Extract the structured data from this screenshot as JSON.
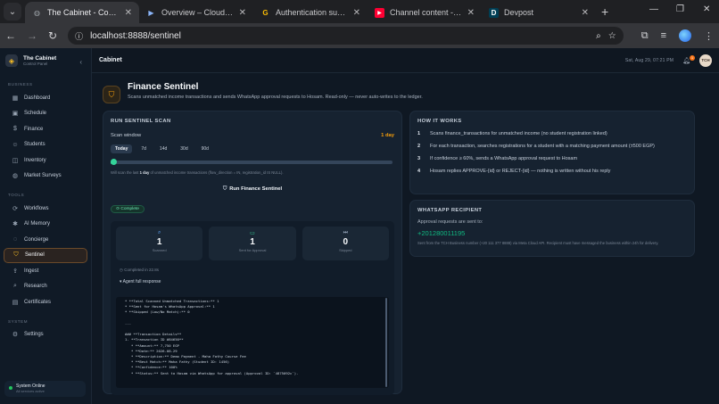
{
  "browser": {
    "tabs": [
      {
        "title": "The Cabinet - Control Ce",
        "icon": "globe-icon",
        "active": true
      },
      {
        "title": "Overview – Cloud Run – I",
        "icon": "cloud-run-icon",
        "active": false
      },
      {
        "title": "Authentication successfu",
        "icon": "google-icon",
        "active": false
      },
      {
        "title": "Channel content - YouTu",
        "icon": "youtube-icon",
        "active": false
      },
      {
        "title": "Devpost",
        "icon": "devpost-icon",
        "active": false
      }
    ],
    "url": "localhost:8888/sentinel"
  },
  "sidebar": {
    "brand_title": "The Cabinet",
    "brand_sub": "Control Panel",
    "sections": [
      {
        "label": "BUSINESS",
        "items": [
          {
            "label": "Dashboard",
            "icon": "grid-icon"
          },
          {
            "label": "Schedule",
            "icon": "calendar-icon"
          },
          {
            "label": "Finance",
            "icon": "dollar-icon"
          },
          {
            "label": "Students",
            "icon": "users-icon"
          },
          {
            "label": "Inventory",
            "icon": "box-icon"
          },
          {
            "label": "Market Surveys",
            "icon": "globe-icon"
          }
        ]
      },
      {
        "label": "TOOLS",
        "items": [
          {
            "label": "Workflows",
            "icon": "workflow-icon"
          },
          {
            "label": "AI Memory",
            "icon": "brain-icon"
          },
          {
            "label": "Concierge",
            "icon": "chat-icon"
          },
          {
            "label": "Sentinel",
            "icon": "shield-icon",
            "active": true
          },
          {
            "label": "Ingest",
            "icon": "upload-icon"
          },
          {
            "label": "Research",
            "icon": "search-icon"
          },
          {
            "label": "Certificates",
            "icon": "certificate-icon"
          }
        ]
      },
      {
        "label": "SYSTEM",
        "items": [
          {
            "label": "Settings",
            "icon": "gear-icon"
          }
        ]
      }
    ],
    "status_title": "System Online",
    "status_sub": "All services active"
  },
  "topbar": {
    "crumb": "Cabinet",
    "time": "Sat, Aug 29, 07:21 PM",
    "notifications": "1",
    "avatar": "TCH"
  },
  "hero": {
    "title": "Finance Sentinel",
    "description": "Scans unmatched income transactions and sends WhatsApp approval requests to Hosam. Read-only — never auto-writes to the ledger."
  },
  "run": {
    "heading": "RUN SENTINEL SCAN",
    "window_label": "Scan window",
    "window_value": "1 day",
    "chips": [
      "Today",
      "7d",
      "14d",
      "30d",
      "90d"
    ],
    "active_chip": 0,
    "slider_fraction": 0.0,
    "hint_pre": "Will scan the last ",
    "hint_bold": "1 day",
    "hint_post": " of unmatched income transactions (flow_direction = IN, registration_id IS NULL).",
    "run_label": "Run Finance Sentinel",
    "status": "Complete",
    "stats": [
      {
        "value": "1",
        "label": "Scanned",
        "icon": "search-icon",
        "color": "#60a5fa"
      },
      {
        "value": "1",
        "label": "Sent for Approval",
        "icon": "message-icon",
        "color": "#34d399"
      },
      {
        "value": "0",
        "label": "Skipped",
        "icon": "skip-icon",
        "color": "#94a3b8"
      }
    ],
    "completed_in": "Completed in 22.8s",
    "agent_toggle": "▾ Agent full response",
    "log": "* **Total Scanned Unmatched Transactions:** 1\n* **Sent for Hosam's WhatsApp Approval:** 1\n* **Skipped (Low/No Match):** 0\n\n---\n\n### **Transaction Details**\n1. **Transaction ID #84650**\n   * **Amount:** 7,750 EGP\n   * **Date:** 2026-08-29\n   * **Description:** Demo Payment - Maha Fathy Course Fee\n   * **Best Match:** Maha Fathy (Student ID: 1456)\n   * **Confidence:** 100%\n   * **Status:** Sent to Hosam via WhatsApp for approval (Approval ID: `4875092c`)."
  },
  "how": {
    "heading": "HOW IT WORKS",
    "steps": [
      "Scans finance_transactions for unmatched income (no student registration linked)",
      "For each transaction, searches registrations for a student with a matching payment amount (±500 EGP)",
      "If confidence ≥ 60%, sends a WhatsApp approval request to Hosam",
      "Hosam replies APPROVE-{id} or REJECT-{id} — nothing is written without his reply"
    ]
  },
  "whatsapp": {
    "heading": "WHATSAPP RECIPIENT",
    "line": "Approval requests are sent to:",
    "number": "+201280011195",
    "note": "Sent from the TCH Business number (+20 111 377 8888) via Meta Cloud API. Recipient must have messaged the business within 24h for delivery."
  },
  "colors": {
    "accent": "#f59e0b",
    "success": "#34d399",
    "whatsapp": "#10b981"
  }
}
